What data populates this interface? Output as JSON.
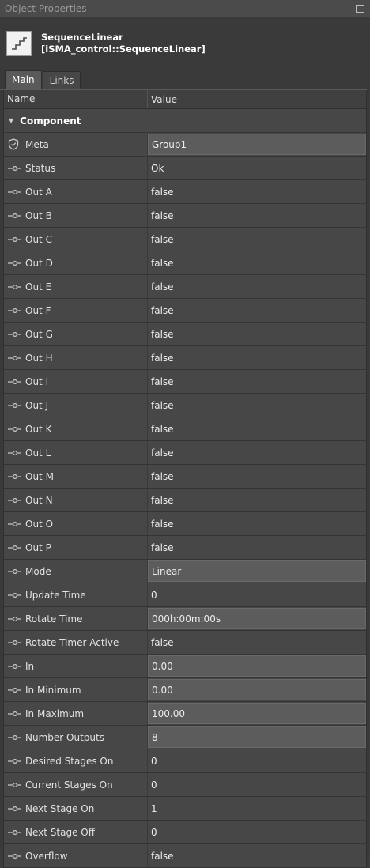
{
  "window": {
    "title": "Object Properties"
  },
  "object": {
    "name": "SequenceLinear",
    "type": "[iSMA_control::SequenceLinear]"
  },
  "tabs": [
    {
      "label": "Main"
    },
    {
      "label": "Links"
    }
  ],
  "columns": {
    "name": "Name",
    "value": "Value"
  },
  "group": {
    "label": "Component"
  },
  "rows": [
    {
      "name": "Meta",
      "value": "Group1"
    },
    {
      "name": "Status",
      "value": "Ok"
    },
    {
      "name": "Out A",
      "value": "false"
    },
    {
      "name": "Out B",
      "value": "false"
    },
    {
      "name": "Out C",
      "value": "false"
    },
    {
      "name": "Out D",
      "value": "false"
    },
    {
      "name": "Out E",
      "value": "false"
    },
    {
      "name": "Out F",
      "value": "false"
    },
    {
      "name": "Out G",
      "value": "false"
    },
    {
      "name": "Out H",
      "value": "false"
    },
    {
      "name": "Out I",
      "value": "false"
    },
    {
      "name": "Out J",
      "value": "false"
    },
    {
      "name": "Out K",
      "value": "false"
    },
    {
      "name": "Out L",
      "value": "false"
    },
    {
      "name": "Out M",
      "value": "false"
    },
    {
      "name": "Out N",
      "value": "false"
    },
    {
      "name": "Out O",
      "value": "false"
    },
    {
      "name": "Out P",
      "value": "false"
    },
    {
      "name": "Mode",
      "value": "Linear"
    },
    {
      "name": "Update Time",
      "value": "0"
    },
    {
      "name": "Rotate Time",
      "value": "000h:00m:00s"
    },
    {
      "name": "Rotate Timer Active",
      "value": "false"
    },
    {
      "name": "In",
      "value": "0.00"
    },
    {
      "name": "In Minimum",
      "value": "0.00"
    },
    {
      "name": "In Maximum",
      "value": "100.00"
    },
    {
      "name": "Number Outputs",
      "value": "8"
    },
    {
      "name": "Desired Stages On",
      "value": "0"
    },
    {
      "name": "Current Stages On",
      "value": "0"
    },
    {
      "name": "Next Stage On",
      "value": "1"
    },
    {
      "name": "Next Stage Off",
      "value": "0"
    },
    {
      "name": "Overflow",
      "value": "false"
    }
  ]
}
